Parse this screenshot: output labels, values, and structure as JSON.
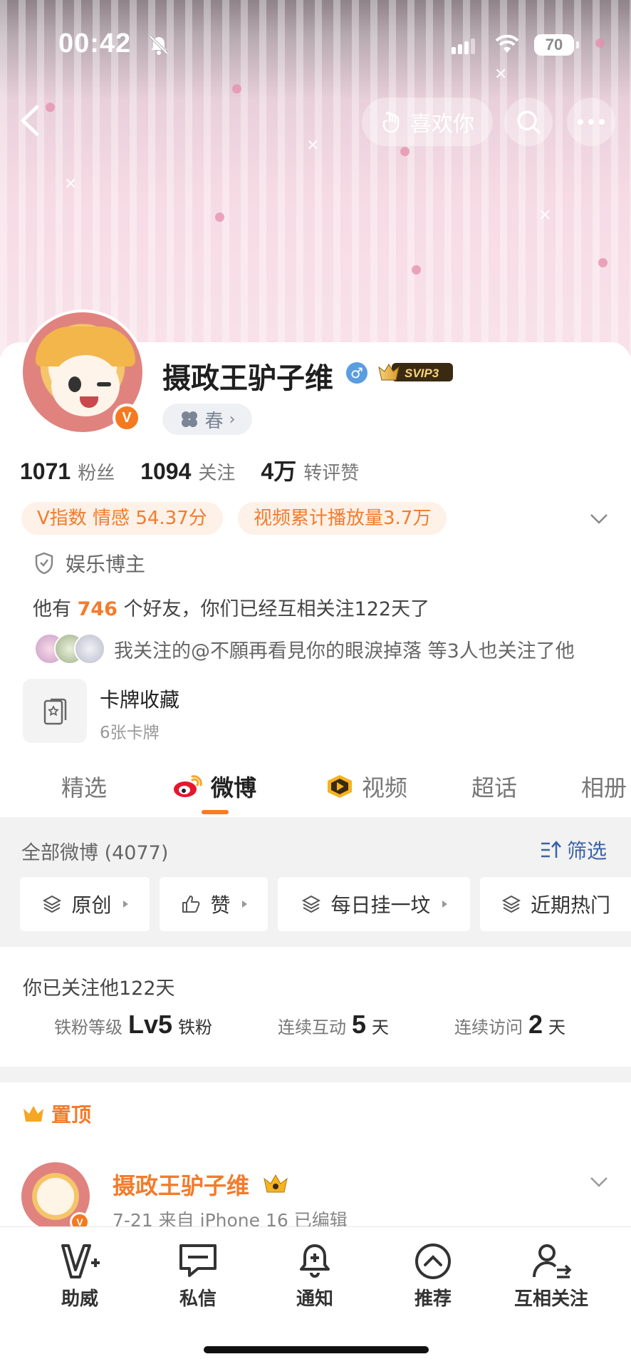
{
  "status_bar": {
    "time": "00:42",
    "battery": "70"
  },
  "header": {
    "like_label": "喜欢你"
  },
  "profile": {
    "name": "摄政王驴子维",
    "gender_symbol": "♂",
    "vip_label": "SVIP3",
    "verified_badge": "V",
    "season_label": "春",
    "stats": [
      {
        "value": "1071",
        "label": "粉丝"
      },
      {
        "value": "1094",
        "label": "关注"
      },
      {
        "value": "4万",
        "label": "转评赞"
      }
    ],
    "tags": [
      "V指数 情感 54.37分",
      "视频累计播放量3.7万"
    ],
    "category": "娱乐博主",
    "friends": {
      "prefix": "他有 ",
      "count": "746",
      "suffix": " 个好友，你们已经互相关注122天了"
    },
    "mutual_text": "我关注的@不願再看見你的眼淚掉落 等3人也关注了他",
    "cards": {
      "title": "卡牌收藏",
      "subtitle": "6张卡牌"
    }
  },
  "tabs": [
    {
      "label": "精选"
    },
    {
      "label": "微博"
    },
    {
      "label": "视频"
    },
    {
      "label": "超话"
    },
    {
      "label": "相册"
    }
  ],
  "filter": {
    "all_label": "全部微博 (4077)",
    "filter_label": "筛选",
    "chips": [
      "原创",
      "赞",
      "每日挂一坟",
      "近期热门"
    ]
  },
  "follow_info": {
    "days_text": "你已关注他122天",
    "metrics": [
      {
        "label": "铁粉等级",
        "value": "Lv5",
        "unit": "铁粉"
      },
      {
        "label": "连续互动",
        "value": "5",
        "unit": "天"
      },
      {
        "label": "连续访问",
        "value": "2",
        "unit": "天"
      }
    ]
  },
  "post": {
    "pinned_label": "置顶",
    "author": "摄政王驴子维",
    "meta": "7-21  来自 iPhone 16  已编辑"
  },
  "bottom_nav": [
    {
      "label": "助威",
      "icon": "cheer-v-icon"
    },
    {
      "label": "私信",
      "icon": "message-icon"
    },
    {
      "label": "通知",
      "icon": "bell-add-icon"
    },
    {
      "label": "推荐",
      "icon": "chevron-up-circle-icon"
    },
    {
      "label": "互相关注",
      "icon": "mutual-follow-icon"
    }
  ],
  "colors": {
    "accent": "#F47B2B",
    "link_blue": "#3C63A8",
    "tab_underline": "#FF7A1E"
  }
}
